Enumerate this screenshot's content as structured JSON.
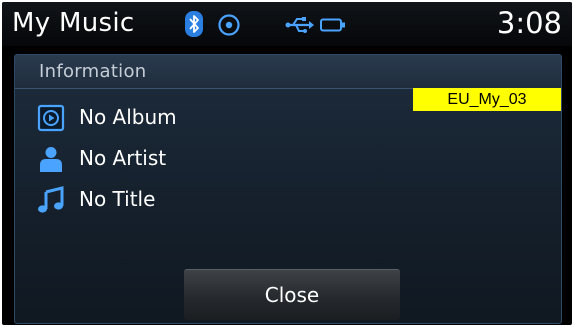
{
  "status_bar": {
    "app_title": "My Music",
    "time": "3:08",
    "icons": [
      "bluetooth-icon",
      "disc-icon",
      "usb-icon",
      "battery-icon"
    ]
  },
  "panel": {
    "title": "Information",
    "tag": "EU_My_03",
    "items": [
      {
        "icon": "album-icon",
        "label": "No Album"
      },
      {
        "icon": "artist-icon",
        "label": "No Artist"
      },
      {
        "icon": "music-note-icon",
        "label": "No Title"
      }
    ],
    "close_label": "Close"
  },
  "colors": {
    "icon_accent": "#4aa3ff",
    "tag_background": "#ffff00"
  }
}
